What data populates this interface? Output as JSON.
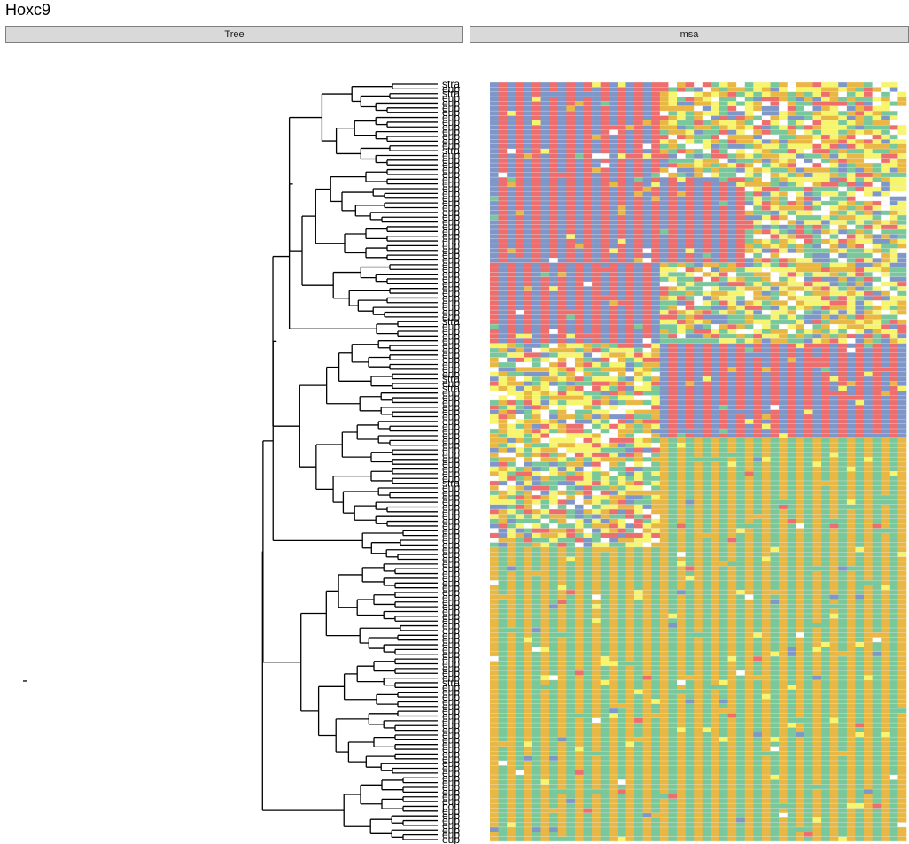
{
  "title": "Hoxc9",
  "panels": [
    {
      "id": "tree",
      "label": "Tree"
    },
    {
      "id": "msa",
      "label": "msa"
    }
  ],
  "colors": {
    "blue": "#7e97c8",
    "red": "#ee6d6d",
    "orange": "#e9b744",
    "green": "#79c89c",
    "yellow": "#f7f56d",
    "white": "#ffffff",
    "gap": "#eeeeee",
    "line": "#000000"
  },
  "chart_data": [
    {
      "panel": "Tree",
      "type": "tree",
      "leaf_count": 160,
      "tip_labels_visible": [
        "stra",
        "stra",
        "stra",
        "stra",
        "stra",
        "stra",
        "stra",
        "stra",
        "pou"
      ],
      "tip_label_prefixes": [
        "stra",
        "eup",
        "pou"
      ]
    },
    {
      "panel": "msa",
      "type": "heatmap",
      "rows": 160,
      "columns": 49,
      "categories": [
        "blue",
        "red",
        "orange",
        "green",
        "yellow",
        "white"
      ]
    }
  ]
}
